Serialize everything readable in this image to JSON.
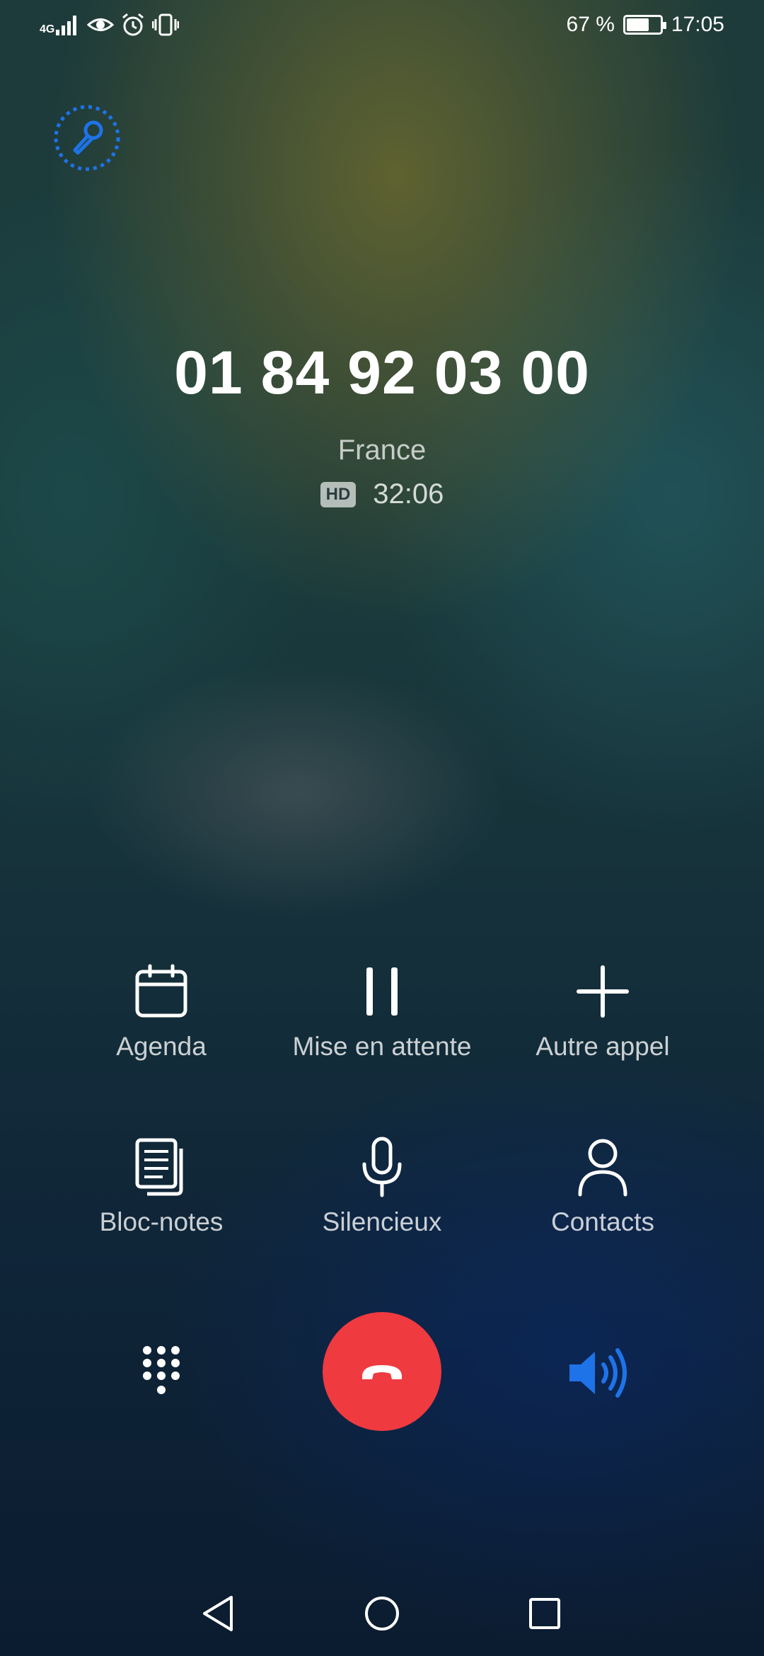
{
  "status_bar": {
    "network": "4G",
    "battery_percent": "67 %",
    "battery_level": 0.67,
    "time": "17:05"
  },
  "call": {
    "number": "01 84 92 03 00",
    "location": "France",
    "hd_badge": "HD",
    "duration": "32:06"
  },
  "actions": [
    {
      "label": "Agenda",
      "icon": "calendar-icon"
    },
    {
      "label": "Mise en attente",
      "icon": "pause-icon"
    },
    {
      "label": "Autre appel",
      "icon": "plus-icon"
    },
    {
      "label": "Bloc-notes",
      "icon": "notes-icon"
    },
    {
      "label": "Silencieux",
      "icon": "microphone-icon"
    },
    {
      "label": "Contacts",
      "icon": "person-icon"
    }
  ],
  "controls": {
    "dialpad_icon": "dialpad-icon",
    "end_call_icon": "end-call-icon",
    "speaker_icon": "speaker-icon",
    "record_icon": "record-microphone-icon"
  },
  "colors": {
    "end_call": "#ef3a3f",
    "accent_blue": "#1e73e8"
  },
  "navigation": [
    "back-icon",
    "home-icon",
    "recents-icon"
  ]
}
